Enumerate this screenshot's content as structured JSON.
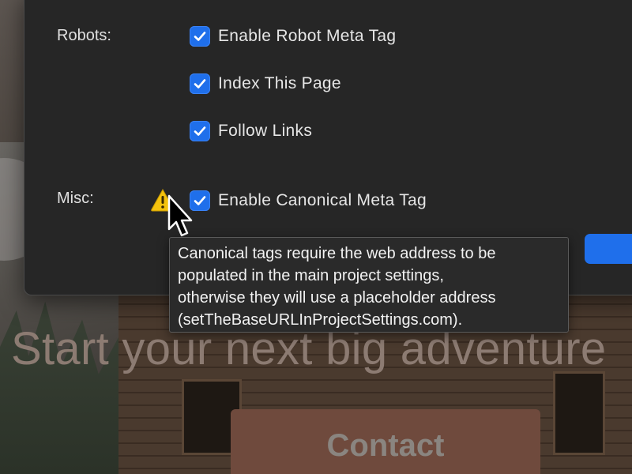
{
  "background_page": {
    "hero_title": "Start your next big adventure",
    "contact_label": "Contact"
  },
  "dialog": {
    "sections": {
      "robots_label": "Robots:",
      "misc_label": "Misc:"
    },
    "options": [
      {
        "label": "Enable Robot Meta Tag",
        "checked": true
      },
      {
        "label": "Index This Page",
        "checked": true
      },
      {
        "label": "Follow Links",
        "checked": true
      },
      {
        "label": "Enable Canonical Meta Tag",
        "checked": true
      }
    ]
  },
  "tooltip": {
    "lines": [
      "Canonical tags require the web address to be",
      "populated in the main project settings,",
      "otherwise they will use a placeholder address",
      "(setTheBaseURLInProjectSettings.com)."
    ]
  },
  "icons": {
    "warning": "warning-icon",
    "checkmark": "checkmark-icon",
    "cursor": "arrow-cursor-icon"
  },
  "colors": {
    "accent": "#1f6feb",
    "dialog_bg": "#262626",
    "warning": "#f4c20d"
  }
}
